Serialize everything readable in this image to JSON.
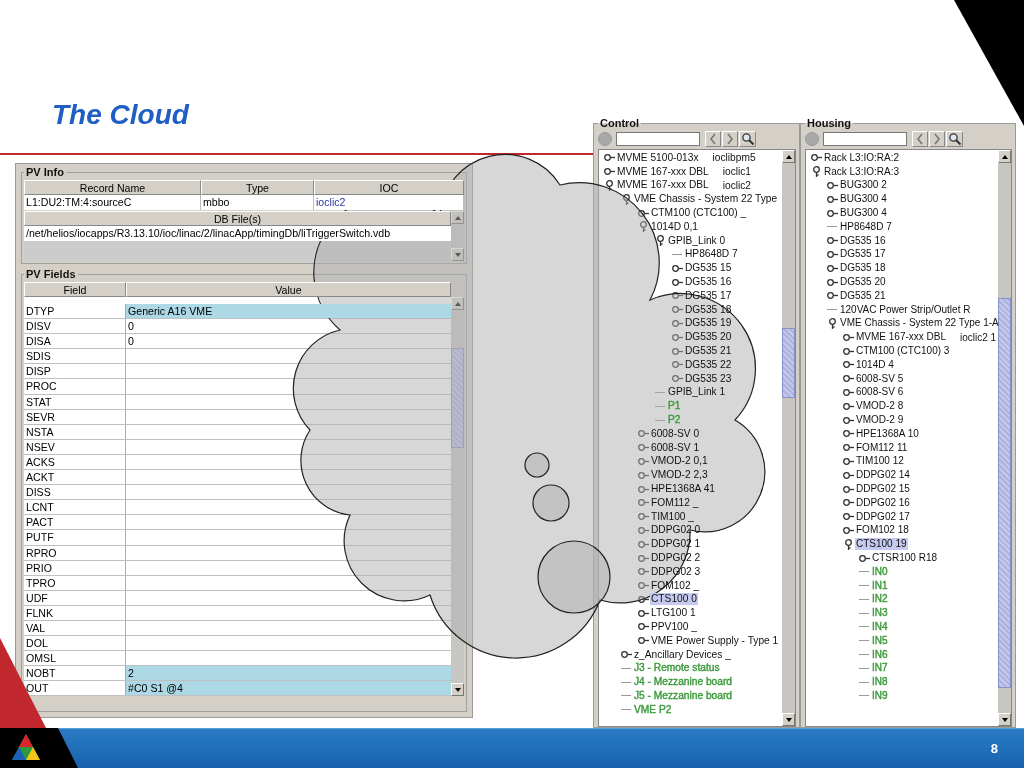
{
  "slide": {
    "title": "The Cloud",
    "page_number": "8"
  },
  "pv_panel": {
    "info_title": "PV Info",
    "info_columns": [
      "Record Name",
      "Type",
      "IOC"
    ],
    "info_row": [
      "L1:DU2:TM:4:sourceC",
      "mbbo",
      "ioclic2"
    ],
    "db_files_header": "DB File(s)",
    "db_files": [
      "/net/helios/iocapps/R3.13.10/ioc/linac/2/linacApp/timingDb/liTriggerSwitch.vdb"
    ],
    "fields_title": "PV Fields",
    "fields_columns": [
      "Field",
      "Value"
    ],
    "fields": [
      {
        "field": "DTYP",
        "value": "Generic A16 VME",
        "selected": true
      },
      {
        "field": "DISV",
        "value": "0",
        "selected": false
      },
      {
        "field": "DISA",
        "value": "0",
        "selected": false
      },
      {
        "field": "SDIS",
        "selected": false
      },
      {
        "field": "DISP",
        "selected": false
      },
      {
        "field": "PROC",
        "selected": false
      },
      {
        "field": "STAT",
        "selected": false
      },
      {
        "field": "SEVR",
        "selected": false
      },
      {
        "field": "NSTA",
        "selected": false
      },
      {
        "field": "NSEV",
        "selected": false
      },
      {
        "field": "ACKS",
        "selected": false
      },
      {
        "field": "ACKT",
        "selected": false
      },
      {
        "field": "DISS",
        "selected": false
      },
      {
        "field": "LCNT",
        "selected": false
      },
      {
        "field": "PACT",
        "selected": false
      },
      {
        "field": "PUTF",
        "selected": false
      },
      {
        "field": "RPRO",
        "selected": false
      },
      {
        "field": "PRIO",
        "selected": false
      },
      {
        "field": "TPRO",
        "selected": false
      },
      {
        "field": "UDF",
        "selected": false
      },
      {
        "field": "FLNK",
        "selected": false
      },
      {
        "field": "VAL",
        "selected": false
      },
      {
        "field": "DOL",
        "selected": false
      },
      {
        "field": "OMSL",
        "selected": false
      },
      {
        "field": "NOBT",
        "value": "2",
        "selected": true
      },
      {
        "field": "OUT",
        "value": "#C0 S1 @4",
        "selected": true
      }
    ]
  },
  "control": {
    "title": "Control",
    "tree": [
      {
        "label": "MVME 5100-013x",
        "ioc": "ioclibpm5",
        "kind": "node",
        "expanded": false,
        "selected": false
      },
      {
        "label": "MVME 167-xxx DBL",
        "ioc": "ioclic1",
        "kind": "node",
        "expanded": false,
        "selected": false
      },
      {
        "label": "MVME 167-xxx DBL",
        "ioc": "ioclic2",
        "kind": "node",
        "expanded": true,
        "selected": false,
        "children": [
          {
            "label": "VME Chassis - System 22 Type",
            "kind": "node",
            "expanded": true,
            "selected": false,
            "children": [
              {
                "label": "CTM100 (CTC100) _",
                "kind": "node",
                "expanded": false,
                "selected": false
              },
              {
                "label": "1014D 0,1",
                "kind": "node",
                "expanded": true,
                "selected": false,
                "children": [
                  {
                    "label": "GPIB_Link 0",
                    "kind": "node",
                    "expanded": true,
                    "selected": false,
                    "children": [
                      {
                        "label": "HP8648D 7",
                        "kind": "leaf",
                        "selected": false
                      },
                      {
                        "label": "DG535 15",
                        "kind": "node",
                        "expanded": false,
                        "selected": false
                      },
                      {
                        "label": "DG535 16",
                        "kind": "node",
                        "expanded": false,
                        "selected": false
                      },
                      {
                        "label": "DG535 17",
                        "kind": "node",
                        "expanded": false,
                        "selected": false
                      },
                      {
                        "label": "DG535 18",
                        "kind": "node",
                        "expanded": false,
                        "selected": false
                      },
                      {
                        "label": "DG535 19",
                        "kind": "node",
                        "expanded": false,
                        "selected": false
                      },
                      {
                        "label": "DG535 20",
                        "kind": "node",
                        "expanded": false,
                        "selected": false
                      },
                      {
                        "label": "DG535 21",
                        "kind": "node",
                        "expanded": false,
                        "selected": false
                      },
                      {
                        "label": "DG535 22",
                        "kind": "node",
                        "expanded": false,
                        "selected": false
                      },
                      {
                        "label": "DG535 23",
                        "kind": "node",
                        "expanded": false,
                        "selected": false
                      }
                    ]
                  },
                  {
                    "label": "GPIB_Link 1",
                    "kind": "leaf",
                    "selected": false
                  },
                  {
                    "label": "P1",
                    "kind": "leaf",
                    "selected": false,
                    "color": "#3c9a3c"
                  },
                  {
                    "label": "P2",
                    "kind": "leaf",
                    "selected": false,
                    "color": "#3c9a3c"
                  }
                ]
              },
              {
                "label": "6008-SV 0",
                "kind": "node",
                "expanded": false,
                "selected": false
              },
              {
                "label": "6008-SV 1",
                "kind": "node",
                "expanded": false,
                "selected": false
              },
              {
                "label": "VMOD-2 0,1",
                "kind": "node",
                "expanded": false,
                "selected": false
              },
              {
                "label": "VMOD-2 2,3",
                "kind": "node",
                "expanded": false,
                "selected": false
              },
              {
                "label": "HPE1368A 41",
                "kind": "node",
                "expanded": false,
                "selected": false
              },
              {
                "label": "FOM112 _",
                "kind": "node",
                "expanded": false,
                "selected": false
              },
              {
                "label": "TIM100 _",
                "kind": "node",
                "expanded": false,
                "selected": false
              },
              {
                "label": "DDPG02 0",
                "kind": "node",
                "expanded": false,
                "selected": false
              },
              {
                "label": "DDPG02 1",
                "kind": "node",
                "expanded": false,
                "selected": false
              },
              {
                "label": "DDPG02 2",
                "kind": "node",
                "expanded": false,
                "selected": false
              },
              {
                "label": "DDPG02 3",
                "kind": "node",
                "expanded": false,
                "selected": false
              },
              {
                "label": "FOM102 _",
                "kind": "node",
                "expanded": false,
                "selected": false
              },
              {
                "label": "CTS100 0",
                "kind": "node",
                "expanded": false,
                "selected": true
              },
              {
                "label": "LTG100 1",
                "kind": "node",
                "expanded": false,
                "selected": false
              },
              {
                "label": "PPV100 _",
                "kind": "node",
                "expanded": false,
                "selected": false
              },
              {
                "label": "VME Power Supply - Type 1",
                "kind": "node",
                "expanded": false,
                "selected": false
              }
            ]
          },
          {
            "label": "z_Ancillary Devices _",
            "kind": "node",
            "expanded": false,
            "selected": false
          },
          {
            "label": "J3 - Remote status",
            "kind": "leaf",
            "selected": false,
            "color": "#3c9a3c"
          },
          {
            "label": "J4 - Mezzanine board",
            "kind": "leaf",
            "selected": false,
            "color": "#3c9a3c"
          },
          {
            "label": "J5 - Mezzanine board",
            "kind": "leaf",
            "selected": false,
            "color": "#3c9a3c"
          },
          {
            "label": "VME P2",
            "kind": "leaf",
            "selected": false,
            "color": "#3c9a3c"
          }
        ]
      }
    ]
  },
  "housing": {
    "title": "Housing",
    "tree": [
      {
        "label": "Rack L3:IO:RA:2",
        "kind": "node",
        "expanded": false,
        "selected": false
      },
      {
        "label": "Rack L3:IO:RA:3",
        "kind": "node",
        "expanded": true,
        "selected": false,
        "children": [
          {
            "label": "BUG300 2",
            "kind": "node",
            "expanded": false,
            "selected": false
          },
          {
            "label": "BUG300 4",
            "kind": "node",
            "expanded": false,
            "selected": false
          },
          {
            "label": "BUG300 4",
            "kind": "node",
            "expanded": false,
            "selected": false
          },
          {
            "label": "HP8648D 7",
            "kind": "leaf",
            "selected": false
          },
          {
            "label": "DG535 16",
            "kind": "node",
            "expanded": false,
            "selected": false
          },
          {
            "label": "DG535 17",
            "kind": "node",
            "expanded": false,
            "selected": false
          },
          {
            "label": "DG535 18",
            "kind": "node",
            "expanded": false,
            "selected": false
          },
          {
            "label": "DG535 20",
            "kind": "node",
            "expanded": false,
            "selected": false
          },
          {
            "label": "DG535 21",
            "kind": "node",
            "expanded": false,
            "selected": false
          },
          {
            "label": "120VAC Power Strip/Outlet R",
            "kind": "leaf",
            "selected": false
          },
          {
            "label": "VME Chassis - System 22 Type 1-A",
            "kind": "node",
            "expanded": true,
            "selected": false,
            "children": [
              {
                "label": "MVME 167-xxx DBL",
                "ioc": "ioclic2 1",
                "kind": "node",
                "expanded": false,
                "selected": false
              },
              {
                "label": "CTM100 (CTC100) 3",
                "kind": "node",
                "expanded": false,
                "selected": false
              },
              {
                "label": "1014D 4",
                "kind": "node",
                "expanded": false,
                "selected": false
              },
              {
                "label": "6008-SV 5",
                "kind": "node",
                "expanded": false,
                "selected": false
              },
              {
                "label": "6008-SV 6",
                "kind": "node",
                "expanded": false,
                "selected": false
              },
              {
                "label": "VMOD-2 8",
                "kind": "node",
                "expanded": false,
                "selected": false
              },
              {
                "label": "VMOD-2 9",
                "kind": "node",
                "expanded": false,
                "selected": false
              },
              {
                "label": "HPE1368A 10",
                "kind": "node",
                "expanded": false,
                "selected": false
              },
              {
                "label": "FOM112 11",
                "kind": "node",
                "expanded": false,
                "selected": false
              },
              {
                "label": "TIM100 12",
                "kind": "node",
                "expanded": false,
                "selected": false
              },
              {
                "label": "DDPG02 14",
                "kind": "node",
                "expanded": false,
                "selected": false
              },
              {
                "label": "DDPG02 15",
                "kind": "node",
                "expanded": false,
                "selected": false
              },
              {
                "label": "DDPG02 16",
                "kind": "node",
                "expanded": false,
                "selected": false
              },
              {
                "label": "DDPG02 17",
                "kind": "node",
                "expanded": false,
                "selected": false
              },
              {
                "label": "FOM102 18",
                "kind": "node",
                "expanded": false,
                "selected": false
              },
              {
                "label": "CTS100 19",
                "kind": "node",
                "expanded": true,
                "selected": true,
                "children": [
                  {
                    "label": "CTSR100 R18",
                    "kind": "node",
                    "expanded": false,
                    "selected": false
                  },
                  {
                    "label": "IN0",
                    "kind": "leaf",
                    "selected": false,
                    "color": "#3c9a3c"
                  },
                  {
                    "label": "IN1",
                    "kind": "leaf",
                    "selected": false,
                    "color": "#3c9a3c"
                  },
                  {
                    "label": "IN2",
                    "kind": "leaf",
                    "selected": false,
                    "color": "#3c9a3c"
                  },
                  {
                    "label": "IN3",
                    "kind": "leaf",
                    "selected": false,
                    "color": "#3c9a3c"
                  },
                  {
                    "label": "IN4",
                    "kind": "leaf",
                    "selected": false,
                    "color": "#3c9a3c"
                  },
                  {
                    "label": "IN5",
                    "kind": "leaf",
                    "selected": false,
                    "color": "#3c9a3c"
                  },
                  {
                    "label": "IN6",
                    "kind": "leaf",
                    "selected": false,
                    "color": "#3c9a3c"
                  },
                  {
                    "label": "IN7",
                    "kind": "leaf",
                    "selected": false,
                    "color": "#3c9a3c"
                  },
                  {
                    "label": "IN8",
                    "kind": "leaf",
                    "selected": false,
                    "color": "#3c9a3c"
                  },
                  {
                    "label": "IN9",
                    "kind": "leaf",
                    "selected": false,
                    "color": "#3c9a3c"
                  }
                ]
              }
            ]
          }
        ]
      }
    ]
  }
}
